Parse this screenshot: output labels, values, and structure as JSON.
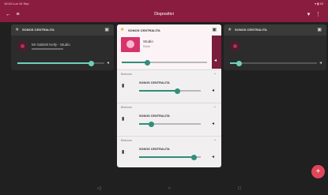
{
  "status_bar": {
    "time": "10:24",
    "date": "Lun 10 Sep",
    "right": "▾ ▮ 63"
  },
  "app_bar": {
    "title": "Dispositivi"
  },
  "cards": {
    "left": {
      "name": "SONOS CENTRALITA",
      "track": "Mr Gabriel Kelly - Studio",
      "progress": 0.85
    },
    "right": {
      "name": "SONOS CENTRALITA",
      "progress": 0.1
    }
  },
  "panel": {
    "name": "SONOS CENTRALITA",
    "track_title": "Studio",
    "track_sub": "Radio",
    "progress": 0.3,
    "groups": [
      {
        "label": "Bedroom",
        "room": "SONOS CENTRALITA",
        "volume": 0.62
      },
      {
        "label": "Bedroom",
        "room": "SONOS CENTRALITA",
        "volume": 0.2
      },
      {
        "label": "Bedroom",
        "room": "SONOS CENTRALITA",
        "volume": 0.88
      }
    ]
  },
  "icons": {
    "back": "back-arrow-icon",
    "menu": "menu-icon",
    "filter": "filter-icon",
    "more": "more-vert-icon",
    "add": "add-icon"
  },
  "colors": {
    "accent": "#8a1c3f",
    "slider": "#2f8f7a",
    "slider_dark_bg": "#6fd0ba",
    "fab": "#e0465a"
  }
}
